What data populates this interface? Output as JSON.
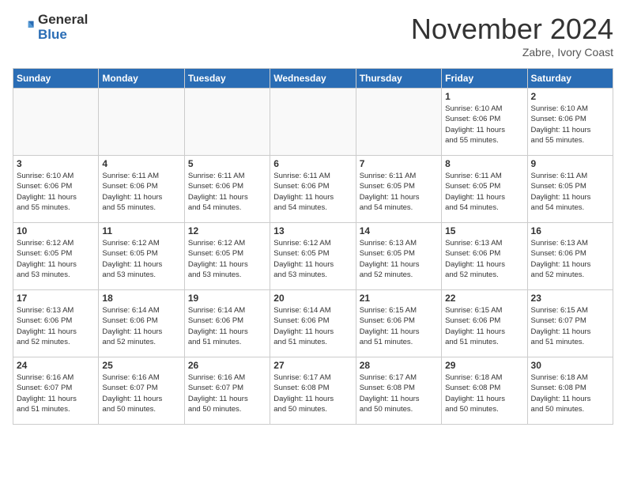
{
  "logo": {
    "general": "General",
    "blue": "Blue"
  },
  "title": "November 2024",
  "location": "Zabre, Ivory Coast",
  "days_of_week": [
    "Sunday",
    "Monday",
    "Tuesday",
    "Wednesday",
    "Thursday",
    "Friday",
    "Saturday"
  ],
  "weeks": [
    [
      {
        "day": "",
        "info": ""
      },
      {
        "day": "",
        "info": ""
      },
      {
        "day": "",
        "info": ""
      },
      {
        "day": "",
        "info": ""
      },
      {
        "day": "",
        "info": ""
      },
      {
        "day": "1",
        "info": "Sunrise: 6:10 AM\nSunset: 6:06 PM\nDaylight: 11 hours\nand 55 minutes."
      },
      {
        "day": "2",
        "info": "Sunrise: 6:10 AM\nSunset: 6:06 PM\nDaylight: 11 hours\nand 55 minutes."
      }
    ],
    [
      {
        "day": "3",
        "info": "Sunrise: 6:10 AM\nSunset: 6:06 PM\nDaylight: 11 hours\nand 55 minutes."
      },
      {
        "day": "4",
        "info": "Sunrise: 6:11 AM\nSunset: 6:06 PM\nDaylight: 11 hours\nand 55 minutes."
      },
      {
        "day": "5",
        "info": "Sunrise: 6:11 AM\nSunset: 6:06 PM\nDaylight: 11 hours\nand 54 minutes."
      },
      {
        "day": "6",
        "info": "Sunrise: 6:11 AM\nSunset: 6:06 PM\nDaylight: 11 hours\nand 54 minutes."
      },
      {
        "day": "7",
        "info": "Sunrise: 6:11 AM\nSunset: 6:05 PM\nDaylight: 11 hours\nand 54 minutes."
      },
      {
        "day": "8",
        "info": "Sunrise: 6:11 AM\nSunset: 6:05 PM\nDaylight: 11 hours\nand 54 minutes."
      },
      {
        "day": "9",
        "info": "Sunrise: 6:11 AM\nSunset: 6:05 PM\nDaylight: 11 hours\nand 54 minutes."
      }
    ],
    [
      {
        "day": "10",
        "info": "Sunrise: 6:12 AM\nSunset: 6:05 PM\nDaylight: 11 hours\nand 53 minutes."
      },
      {
        "day": "11",
        "info": "Sunrise: 6:12 AM\nSunset: 6:05 PM\nDaylight: 11 hours\nand 53 minutes."
      },
      {
        "day": "12",
        "info": "Sunrise: 6:12 AM\nSunset: 6:05 PM\nDaylight: 11 hours\nand 53 minutes."
      },
      {
        "day": "13",
        "info": "Sunrise: 6:12 AM\nSunset: 6:05 PM\nDaylight: 11 hours\nand 53 minutes."
      },
      {
        "day": "14",
        "info": "Sunrise: 6:13 AM\nSunset: 6:05 PM\nDaylight: 11 hours\nand 52 minutes."
      },
      {
        "day": "15",
        "info": "Sunrise: 6:13 AM\nSunset: 6:06 PM\nDaylight: 11 hours\nand 52 minutes."
      },
      {
        "day": "16",
        "info": "Sunrise: 6:13 AM\nSunset: 6:06 PM\nDaylight: 11 hours\nand 52 minutes."
      }
    ],
    [
      {
        "day": "17",
        "info": "Sunrise: 6:13 AM\nSunset: 6:06 PM\nDaylight: 11 hours\nand 52 minutes."
      },
      {
        "day": "18",
        "info": "Sunrise: 6:14 AM\nSunset: 6:06 PM\nDaylight: 11 hours\nand 52 minutes."
      },
      {
        "day": "19",
        "info": "Sunrise: 6:14 AM\nSunset: 6:06 PM\nDaylight: 11 hours\nand 51 minutes."
      },
      {
        "day": "20",
        "info": "Sunrise: 6:14 AM\nSunset: 6:06 PM\nDaylight: 11 hours\nand 51 minutes."
      },
      {
        "day": "21",
        "info": "Sunrise: 6:15 AM\nSunset: 6:06 PM\nDaylight: 11 hours\nand 51 minutes."
      },
      {
        "day": "22",
        "info": "Sunrise: 6:15 AM\nSunset: 6:06 PM\nDaylight: 11 hours\nand 51 minutes."
      },
      {
        "day": "23",
        "info": "Sunrise: 6:15 AM\nSunset: 6:07 PM\nDaylight: 11 hours\nand 51 minutes."
      }
    ],
    [
      {
        "day": "24",
        "info": "Sunrise: 6:16 AM\nSunset: 6:07 PM\nDaylight: 11 hours\nand 51 minutes."
      },
      {
        "day": "25",
        "info": "Sunrise: 6:16 AM\nSunset: 6:07 PM\nDaylight: 11 hours\nand 50 minutes."
      },
      {
        "day": "26",
        "info": "Sunrise: 6:16 AM\nSunset: 6:07 PM\nDaylight: 11 hours\nand 50 minutes."
      },
      {
        "day": "27",
        "info": "Sunrise: 6:17 AM\nSunset: 6:08 PM\nDaylight: 11 hours\nand 50 minutes."
      },
      {
        "day": "28",
        "info": "Sunrise: 6:17 AM\nSunset: 6:08 PM\nDaylight: 11 hours\nand 50 minutes."
      },
      {
        "day": "29",
        "info": "Sunrise: 6:18 AM\nSunset: 6:08 PM\nDaylight: 11 hours\nand 50 minutes."
      },
      {
        "day": "30",
        "info": "Sunrise: 6:18 AM\nSunset: 6:08 PM\nDaylight: 11 hours\nand 50 minutes."
      }
    ]
  ]
}
